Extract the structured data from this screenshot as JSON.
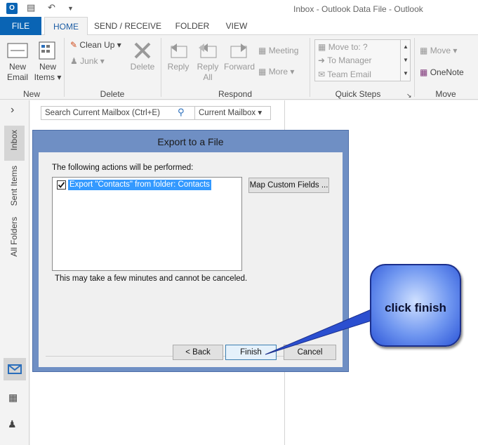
{
  "window": {
    "title": "Inbox - Outlook Data File - Outlook",
    "app_icon": "O"
  },
  "tabs": [
    {
      "label": "FILE"
    },
    {
      "label": "HOME"
    },
    {
      "label": "SEND / RECEIVE"
    },
    {
      "label": "FOLDER"
    },
    {
      "label": "VIEW"
    }
  ],
  "ribbon": {
    "new": {
      "new_email_1": "New",
      "new_email_2": "Email",
      "new_items_1": "New",
      "new_items_2": "Items ▾",
      "group": "New"
    },
    "delete": {
      "clean_up": "Clean Up ▾",
      "junk": "Junk ▾",
      "delete": "Delete",
      "group": "Delete"
    },
    "respond": {
      "reply": "Reply",
      "reply_all_1": "Reply",
      "reply_all_2": "All",
      "forward": "Forward",
      "meeting": "Meeting",
      "more": "More ▾",
      "group": "Respond"
    },
    "quick_steps": {
      "items": [
        "Move to: ?",
        "To Manager",
        "Team Email"
      ],
      "group": "Quick Steps"
    },
    "move": {
      "move": "Move ▾",
      "onenote": "OneNote",
      "group": "Move"
    }
  },
  "nav": {
    "inbox": "Inbox",
    "sent": "Sent Items",
    "all": "All Folders",
    "expand": "›"
  },
  "search": {
    "placeholder": "Search Current Mailbox (Ctrl+E)",
    "scope": "Current Mailbox ▾"
  },
  "dialog": {
    "title": "Export to a File",
    "actions_label": "The following actions will be performed:",
    "action_item": "Export \"Contacts\" from folder: Contacts",
    "map_button": "Map Custom Fields ...",
    "note": "This may take a few minutes and cannot be canceled.",
    "back": "< Back",
    "finish": "Finish",
    "cancel": "Cancel"
  },
  "callout": {
    "text": "click finish"
  },
  "colors": {
    "accent": "#0a64b4",
    "dialog_frame": "#6f8fc4",
    "selection": "#3399ff",
    "callout": "#5b87ee"
  }
}
